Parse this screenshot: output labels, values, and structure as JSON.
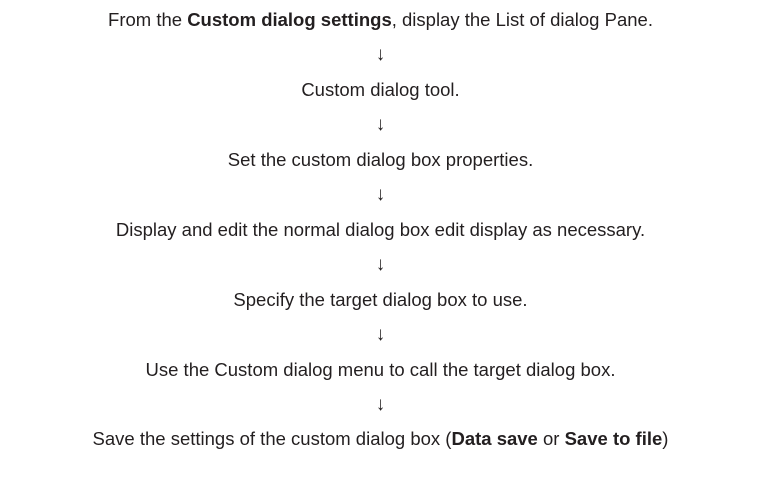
{
  "flow": {
    "arrow_glyph": "↓",
    "steps": [
      {
        "pre": "From the ",
        "bold": "Custom dialog settings",
        "post": ", display the List of dialog Pane."
      },
      {
        "text": "Custom dialog tool."
      },
      {
        "text": "Set the custom dialog box properties."
      },
      {
        "text": "Display and edit the normal dialog box edit display as necessary."
      },
      {
        "text": "Specify the target dialog box to use."
      },
      {
        "text": "Use the Custom dialog menu to call the target dialog box."
      },
      {
        "pre": "Save the settings of the custom dialog box (",
        "bold1": "Data save",
        "mid": " or ",
        "bold2": "Save to file",
        "post": ")"
      }
    ]
  }
}
